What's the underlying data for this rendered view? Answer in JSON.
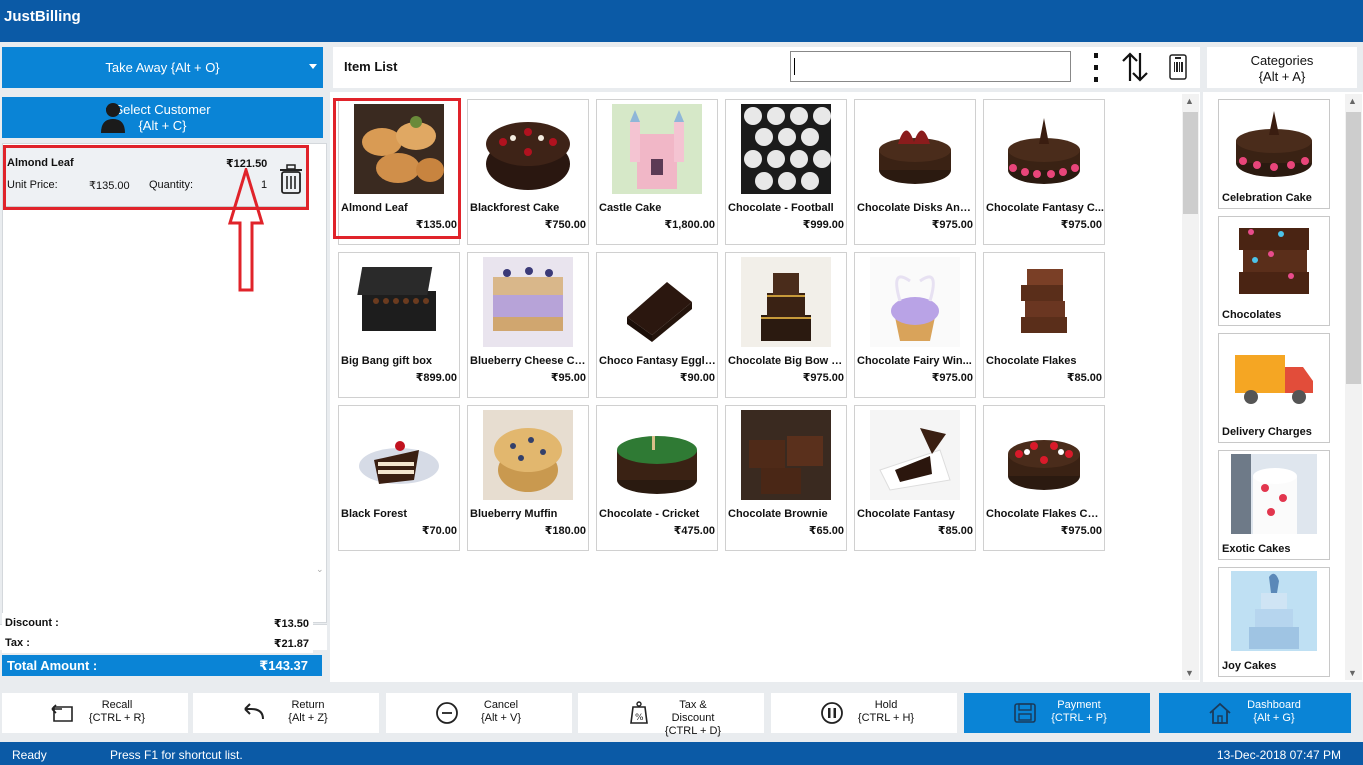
{
  "app": {
    "title": "JustBilling"
  },
  "left": {
    "order_type": "Take Away {Alt + O}",
    "customer_line1": "Select Customer",
    "customer_line2": "{Alt + C}",
    "cart_items": [
      {
        "name": "Almond Leaf",
        "total": "₹121.50",
        "unit_price_label": "Unit Price:",
        "unit_price": "₹135.00",
        "quantity_label": "Quantity:",
        "quantity": "1"
      }
    ],
    "discount_label": "Discount :",
    "discount": "₹13.50",
    "tax_label": "Tax :",
    "tax": "₹21.87",
    "total_label": "Total Amount :",
    "total": "₹143.37"
  },
  "center": {
    "title": "Item List",
    "search_value": "",
    "items": [
      {
        "name": "Almond Leaf",
        "price": "₹135.00"
      },
      {
        "name": "Blackforest Cake",
        "price": "₹750.00"
      },
      {
        "name": "Castle Cake",
        "price": "₹1,800.00"
      },
      {
        "name": "Chocolate - Football",
        "price": "₹999.00"
      },
      {
        "name": "Chocolate Disks And...",
        "price": "₹975.00"
      },
      {
        "name": "Chocolate Fantasy C...",
        "price": "₹975.00"
      },
      {
        "name": "Big Bang gift box",
        "price": "₹899.00"
      },
      {
        "name": "Blueberry Cheese Ca...",
        "price": "₹95.00"
      },
      {
        "name": "Choco Fantasy Eggle...",
        "price": "₹90.00"
      },
      {
        "name": "Chocolate Big Bow C...",
        "price": "₹975.00"
      },
      {
        "name": "Chocolate Fairy Win...",
        "price": "₹975.00"
      },
      {
        "name": "Chocolate Flakes",
        "price": "₹85.00"
      },
      {
        "name": "Black Forest",
        "price": "₹70.00"
      },
      {
        "name": "Blueberry Muffin",
        "price": "₹180.00"
      },
      {
        "name": "Chocolate - Cricket",
        "price": "₹475.00"
      },
      {
        "name": "Chocolate Brownie",
        "price": "₹65.00"
      },
      {
        "name": "Chocolate Fantasy",
        "price": "₹85.00"
      },
      {
        "name": "Chocolate Flakes Cake",
        "price": "₹975.00"
      }
    ]
  },
  "categories": {
    "title_line1": "Categories",
    "title_line2": "{Alt + A}",
    "items": [
      {
        "name": "Celebration Cake"
      },
      {
        "name": "Chocolates"
      },
      {
        "name": "Delivery Charges"
      },
      {
        "name": "Exotic Cakes"
      },
      {
        "name": "Joy Cakes"
      }
    ]
  },
  "actions": [
    {
      "label": "Recall",
      "shortcut": "{CTRL + R}",
      "icon": "recall-icon"
    },
    {
      "label": "Return",
      "shortcut": "{Alt + Z}",
      "icon": "return-icon"
    },
    {
      "label": "Cancel",
      "shortcut": "{Alt + V}",
      "icon": "cancel-icon"
    },
    {
      "label": "Tax & Discount",
      "shortcut": "{CTRL + D}",
      "icon": "tax-discount-icon"
    },
    {
      "label": "Hold",
      "shortcut": "{CTRL + H}",
      "icon": "hold-icon"
    },
    {
      "label": "Payment",
      "shortcut": "{CTRL + P}",
      "icon": "payment-icon"
    },
    {
      "label": "Dashboard",
      "shortcut": "{Alt + G}",
      "icon": "dashboard-icon"
    }
  ],
  "status": {
    "state": "Ready",
    "hint": "Press F1 for shortcut list.",
    "datetime": "13-Dec-2018 07:47 PM"
  },
  "colors": {
    "brand": "#0b5aa6",
    "accent": "#0a84d6",
    "highlight": "#e0232a"
  }
}
